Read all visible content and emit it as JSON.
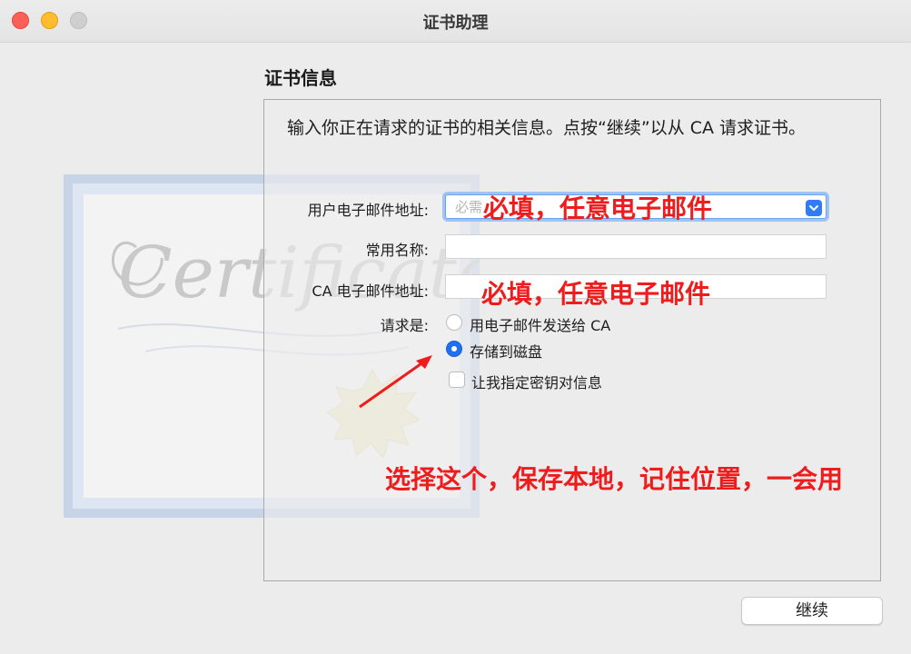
{
  "window": {
    "title": "证书助理"
  },
  "section_title": "证书信息",
  "intro": "输入你正在请求的证书的相关信息。点按“继续”以从 CA 请求证书。",
  "form": {
    "email": {
      "label": "用户电子邮件地址:",
      "placeholder": "必需",
      "value": ""
    },
    "common_name": {
      "label": "常用名称:",
      "value": ""
    },
    "ca_email": {
      "label": "CA 电子邮件地址:",
      "value": ""
    },
    "request_is": {
      "label": "请求是:"
    },
    "options": [
      {
        "label": "用电子邮件发送给 CA",
        "selected": false
      },
      {
        "label": "存储到磁盘",
        "selected": true
      }
    ],
    "checkbox": {
      "label": "让我指定密钥对信息",
      "checked": false
    }
  },
  "annotations": {
    "email_note": "必填，任意电子邮件",
    "ca_email_note": "必填，任意电子邮件",
    "save_note": "选择这个，保存本地，记住位置，一会用"
  },
  "buttons": {
    "continue": "继续"
  },
  "colors": {
    "accent": "#1f6ff2",
    "annotation": "#ee1c1c",
    "focus_ring": "#9ec3f4"
  },
  "icons": {
    "traffic_lights": [
      "close-icon",
      "minimize-icon",
      "zoom-icon"
    ],
    "combo": "chevron-down-icon",
    "background_art": "certificate-icon"
  }
}
